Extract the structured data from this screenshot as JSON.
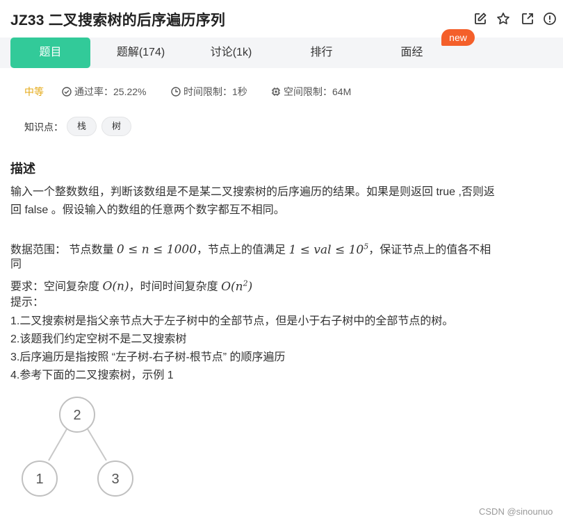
{
  "header": {
    "title": "JZ33  二叉搜索树的后序遍历序列",
    "icons": [
      "edit-icon",
      "star-icon",
      "share-icon",
      "info-icon"
    ]
  },
  "tabs": [
    {
      "label": "题目",
      "active": true
    },
    {
      "label": "题解(174)",
      "active": false
    },
    {
      "label": "讨论(1k)",
      "active": false
    },
    {
      "label": "排行",
      "active": false
    },
    {
      "label": "面经",
      "active": false
    }
  ],
  "new_badge": "new",
  "meta": {
    "difficulty": "中等",
    "pass_rate": "通过率：25.22%",
    "time_limit": "时间限制：1秒",
    "space_limit": "空间限制：64M"
  },
  "knowledge": {
    "label": "知识点：",
    "tags": [
      "栈",
      "树"
    ]
  },
  "description": {
    "heading": "描述",
    "p1_line1": "输入一个整数数组，判断该数组是不是某二叉搜索树的后序遍历的结果。如果是则返回 true ,否则返",
    "p1_line2": "回 false 。假设输入的数组的任意两个数字都互不相同。",
    "range_prefix": "数据范围： 节点数量 ",
    "range_math1": "0 ≤ n ≤ 1000",
    "range_mid": "，节点上的值满足 ",
    "range_math2_base": "1 ≤ val ≤ 10",
    "range_math2_exp": "5",
    "range_suffix": "，保证节点上的值各不相",
    "range_line2": "同",
    "req_prefix": "要求：空间复杂度 ",
    "req_math1": "O(n)",
    "req_mid": "，时间时间复杂度 ",
    "req_math2_base": "O(n",
    "req_math2_exp": "2",
    "req_math2_close": ")",
    "hint_title": "提示：",
    "hint1": "1.二叉搜索树是指父亲节点大于左子树中的全部节点，但是小于右子树中的全部节点的树。",
    "hint2": "2.该题我们约定空树不是二叉搜索树",
    "hint3": "3.后序遍历是指按照 “左子树-右子树-根节点” 的顺序遍历",
    "hint4": "4.参考下面的二叉搜索树，示例 1"
  },
  "tree": {
    "root": "2",
    "left": "1",
    "right": "3"
  },
  "watermark": "CSDN @sinounuo"
}
